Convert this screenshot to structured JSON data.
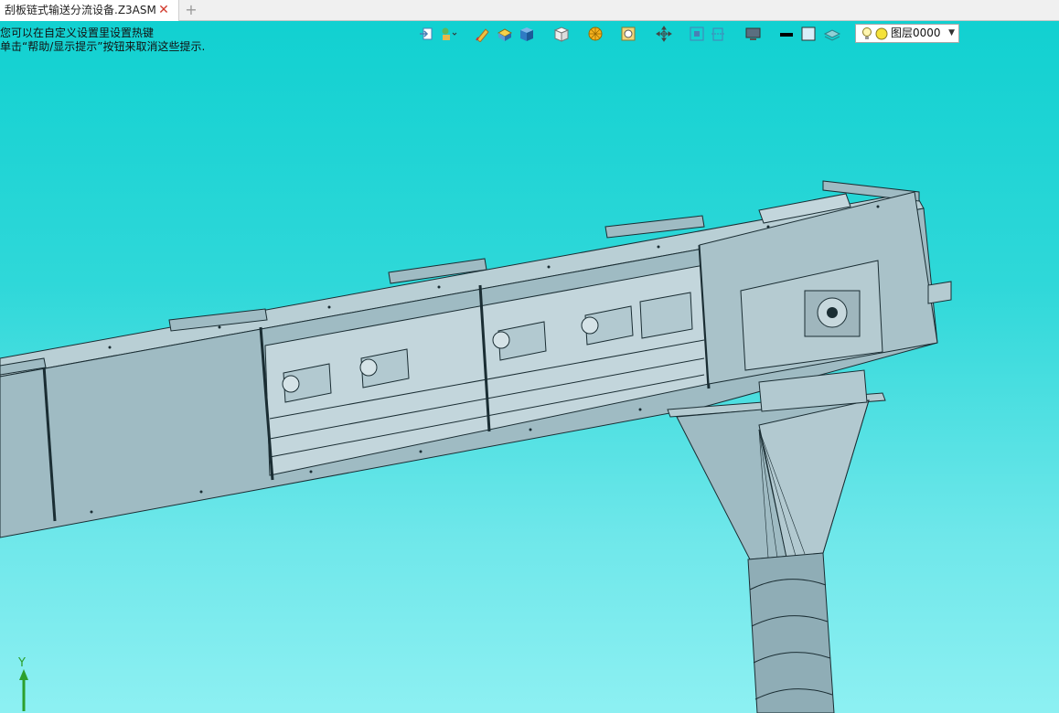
{
  "tab": {
    "title": "刮板链式输送分流设备.Z3ASM",
    "close_icon": "close-icon",
    "new_icon": "plus-icon"
  },
  "hint": {
    "line1": "您可以在自定义设置里设置热键",
    "line2": "单击“帮助/显示提示”按钮来取消这些提示."
  },
  "toolbar": {
    "layer_label": "图层0000",
    "icons": [
      "exit-part-icon",
      "assembly-icon",
      "sketch-icon",
      "shaded-part-icon",
      "view-cube-icon",
      "view-orientation-icon",
      "render-mode-icon",
      "zoom-icon",
      "pan-icon",
      "fit-view-icon",
      "section-view-icon",
      "display-icon",
      "line-color-icon",
      "fill-color-icon",
      "layer-icon",
      "bulb-icon",
      "layer-dot-icon"
    ]
  },
  "axis": {
    "label": "Y"
  },
  "colors": {
    "background_top": "#0fd0d0",
    "background_bottom": "#8df0f2",
    "model": "#a7c3cb",
    "edge": "#1a2d33"
  }
}
